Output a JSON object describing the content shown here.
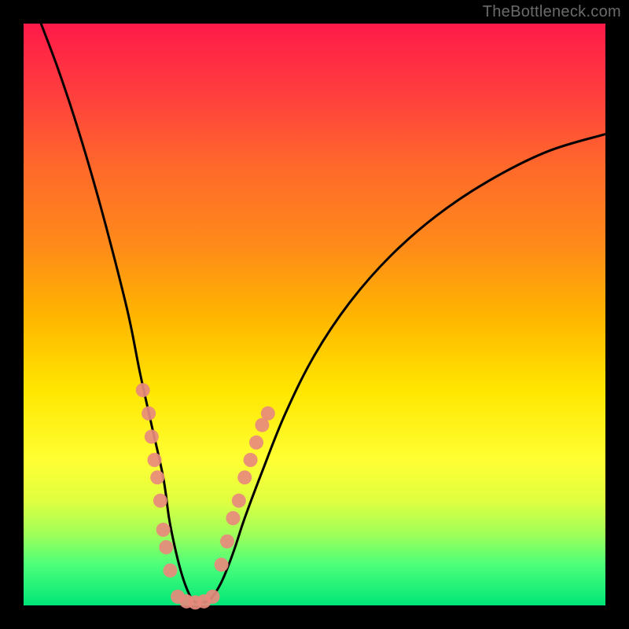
{
  "watermark": "TheBottleneck.com",
  "chart_data": {
    "type": "line",
    "title": "",
    "xlabel": "",
    "ylabel": "",
    "xlim": [
      0,
      100
    ],
    "ylim": [
      0,
      100
    ],
    "background_gradient": {
      "top": "#ff1a49",
      "upper_mid": "#ff8a1a",
      "mid": "#ffe600",
      "lower_mid": "#e0ff40",
      "bottom": "#00e676"
    },
    "series": [
      {
        "name": "bottleneck-curve",
        "color": "#000000",
        "x": [
          3,
          6,
          9,
          12,
          15,
          18,
          20,
          22,
          24,
          25,
          26,
          27,
          28,
          29,
          30,
          32,
          34,
          36,
          38,
          41,
          45,
          50,
          56,
          63,
          71,
          80,
          90,
          100
        ],
        "values": [
          100,
          92,
          83,
          73,
          62,
          50,
          40,
          31,
          22,
          15,
          10,
          6,
          3,
          1,
          0.5,
          1,
          4,
          9,
          15,
          23,
          33,
          43,
          52,
          60,
          67,
          73,
          78,
          81
        ]
      }
    ],
    "markers": [
      {
        "name": "left-cluster",
        "color": "#e88a7d",
        "points": [
          {
            "x": 20.5,
            "y": 37
          },
          {
            "x": 21.5,
            "y": 33
          },
          {
            "x": 22.0,
            "y": 29
          },
          {
            "x": 22.5,
            "y": 25
          },
          {
            "x": 23.0,
            "y": 22
          },
          {
            "x": 23.5,
            "y": 18
          },
          {
            "x": 24.0,
            "y": 13
          },
          {
            "x": 24.5,
            "y": 10
          },
          {
            "x": 25.2,
            "y": 6
          }
        ]
      },
      {
        "name": "trough-cluster",
        "color": "#e88a7d",
        "points": [
          {
            "x": 26.5,
            "y": 1.5
          },
          {
            "x": 28.0,
            "y": 0.7
          },
          {
            "x": 29.5,
            "y": 0.5
          },
          {
            "x": 31.0,
            "y": 0.7
          },
          {
            "x": 32.5,
            "y": 1.5
          }
        ]
      },
      {
        "name": "right-cluster",
        "color": "#e88a7d",
        "points": [
          {
            "x": 34.0,
            "y": 7
          },
          {
            "x": 35.0,
            "y": 11
          },
          {
            "x": 36.0,
            "y": 15
          },
          {
            "x": 37.0,
            "y": 18
          },
          {
            "x": 38.0,
            "y": 22
          },
          {
            "x": 39.0,
            "y": 25
          },
          {
            "x": 40.0,
            "y": 28
          },
          {
            "x": 41.0,
            "y": 31
          },
          {
            "x": 42.0,
            "y": 33
          }
        ]
      }
    ]
  }
}
